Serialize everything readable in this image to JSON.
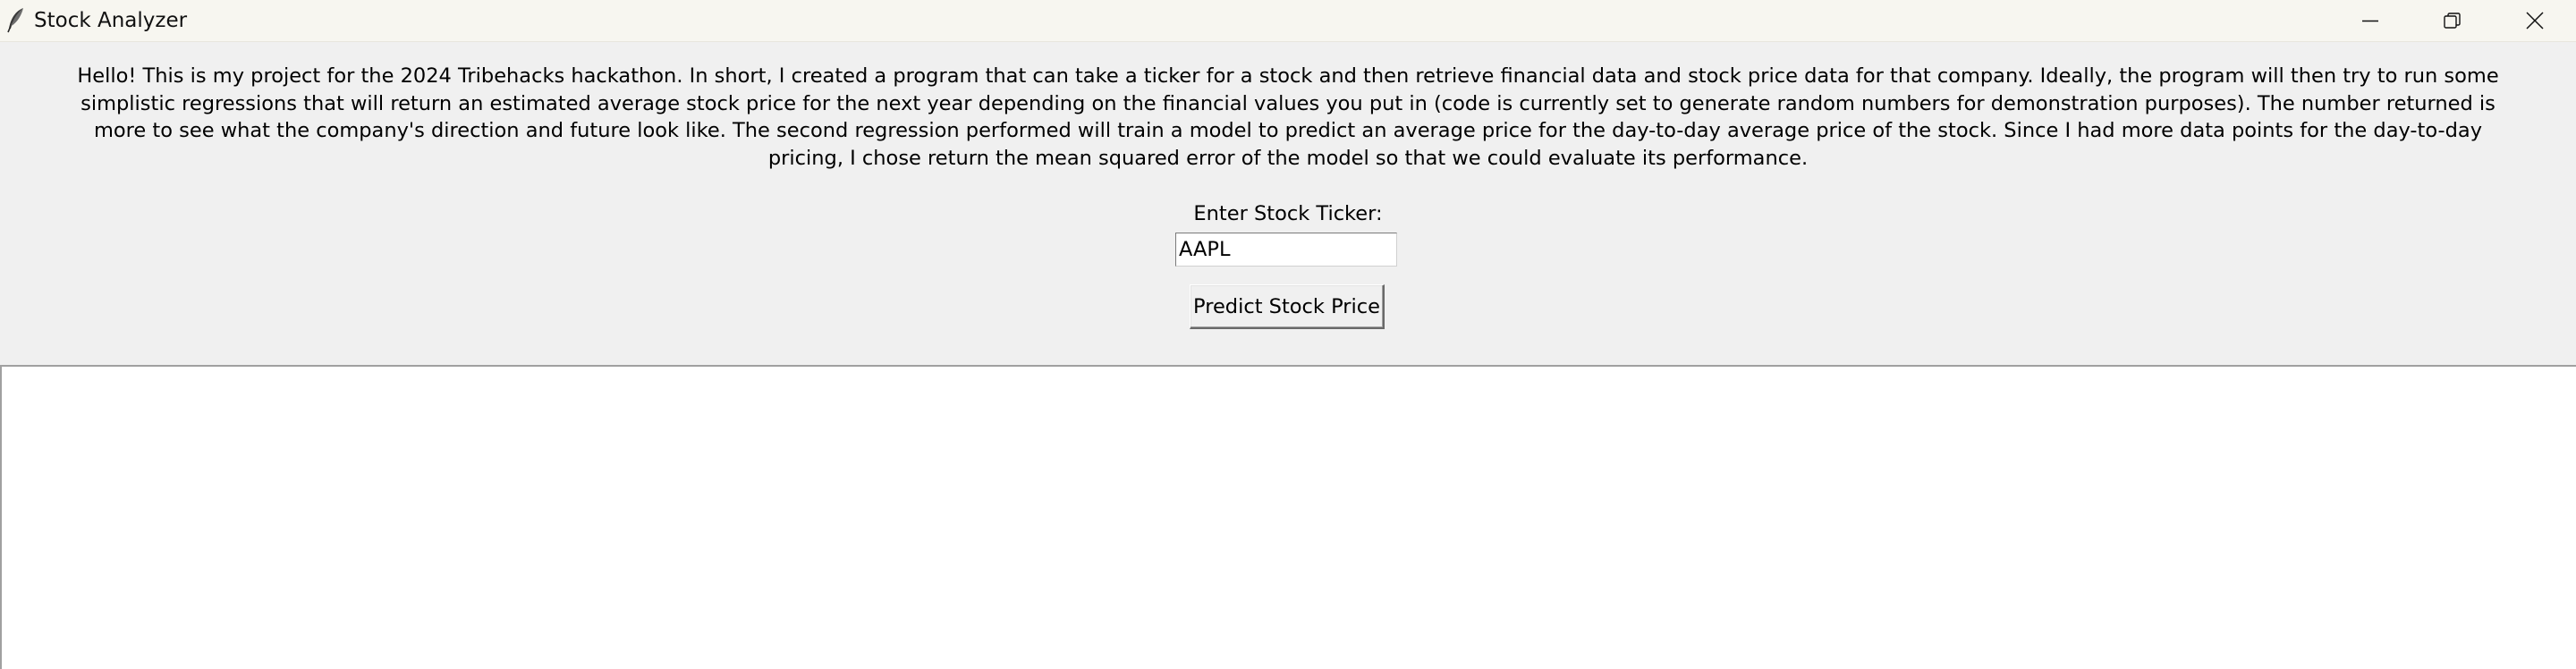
{
  "window": {
    "title": "Stock Analyzer",
    "app_icon": "feather-icon",
    "controls": {
      "minimize_icon": "minimize-icon",
      "restore_icon": "restore-icon",
      "close_icon": "close-icon"
    }
  },
  "main": {
    "description": "Hello! This is my project for the 2024 Tribehacks hackathon. In short, I created a program that can take a ticker for a stock and then retrieve financial data and stock price data for that company. Ideally, the program will then try to run some simplistic regressions that will return an estimated average stock price for the next year depending on the financial values you put in (code is currently set to generate random numbers for demonstration purposes). The number returned is more to see what the company's direction and future look like. The second regression performed will train a model to predict an average price for the day-to-day average price of the stock. Since I had more data points for the day-to-day pricing, I chose return the mean squared error of the model so that we could evaluate its performance.",
    "ticker_label": "Enter Stock Ticker:",
    "ticker_value": "AAPL",
    "predict_button_label": "Predict Stock Price",
    "output_text": ""
  },
  "colors": {
    "window_background": "#f0f0f0",
    "titlebar_background": "#f7f6f0",
    "output_background": "#ffffff"
  }
}
